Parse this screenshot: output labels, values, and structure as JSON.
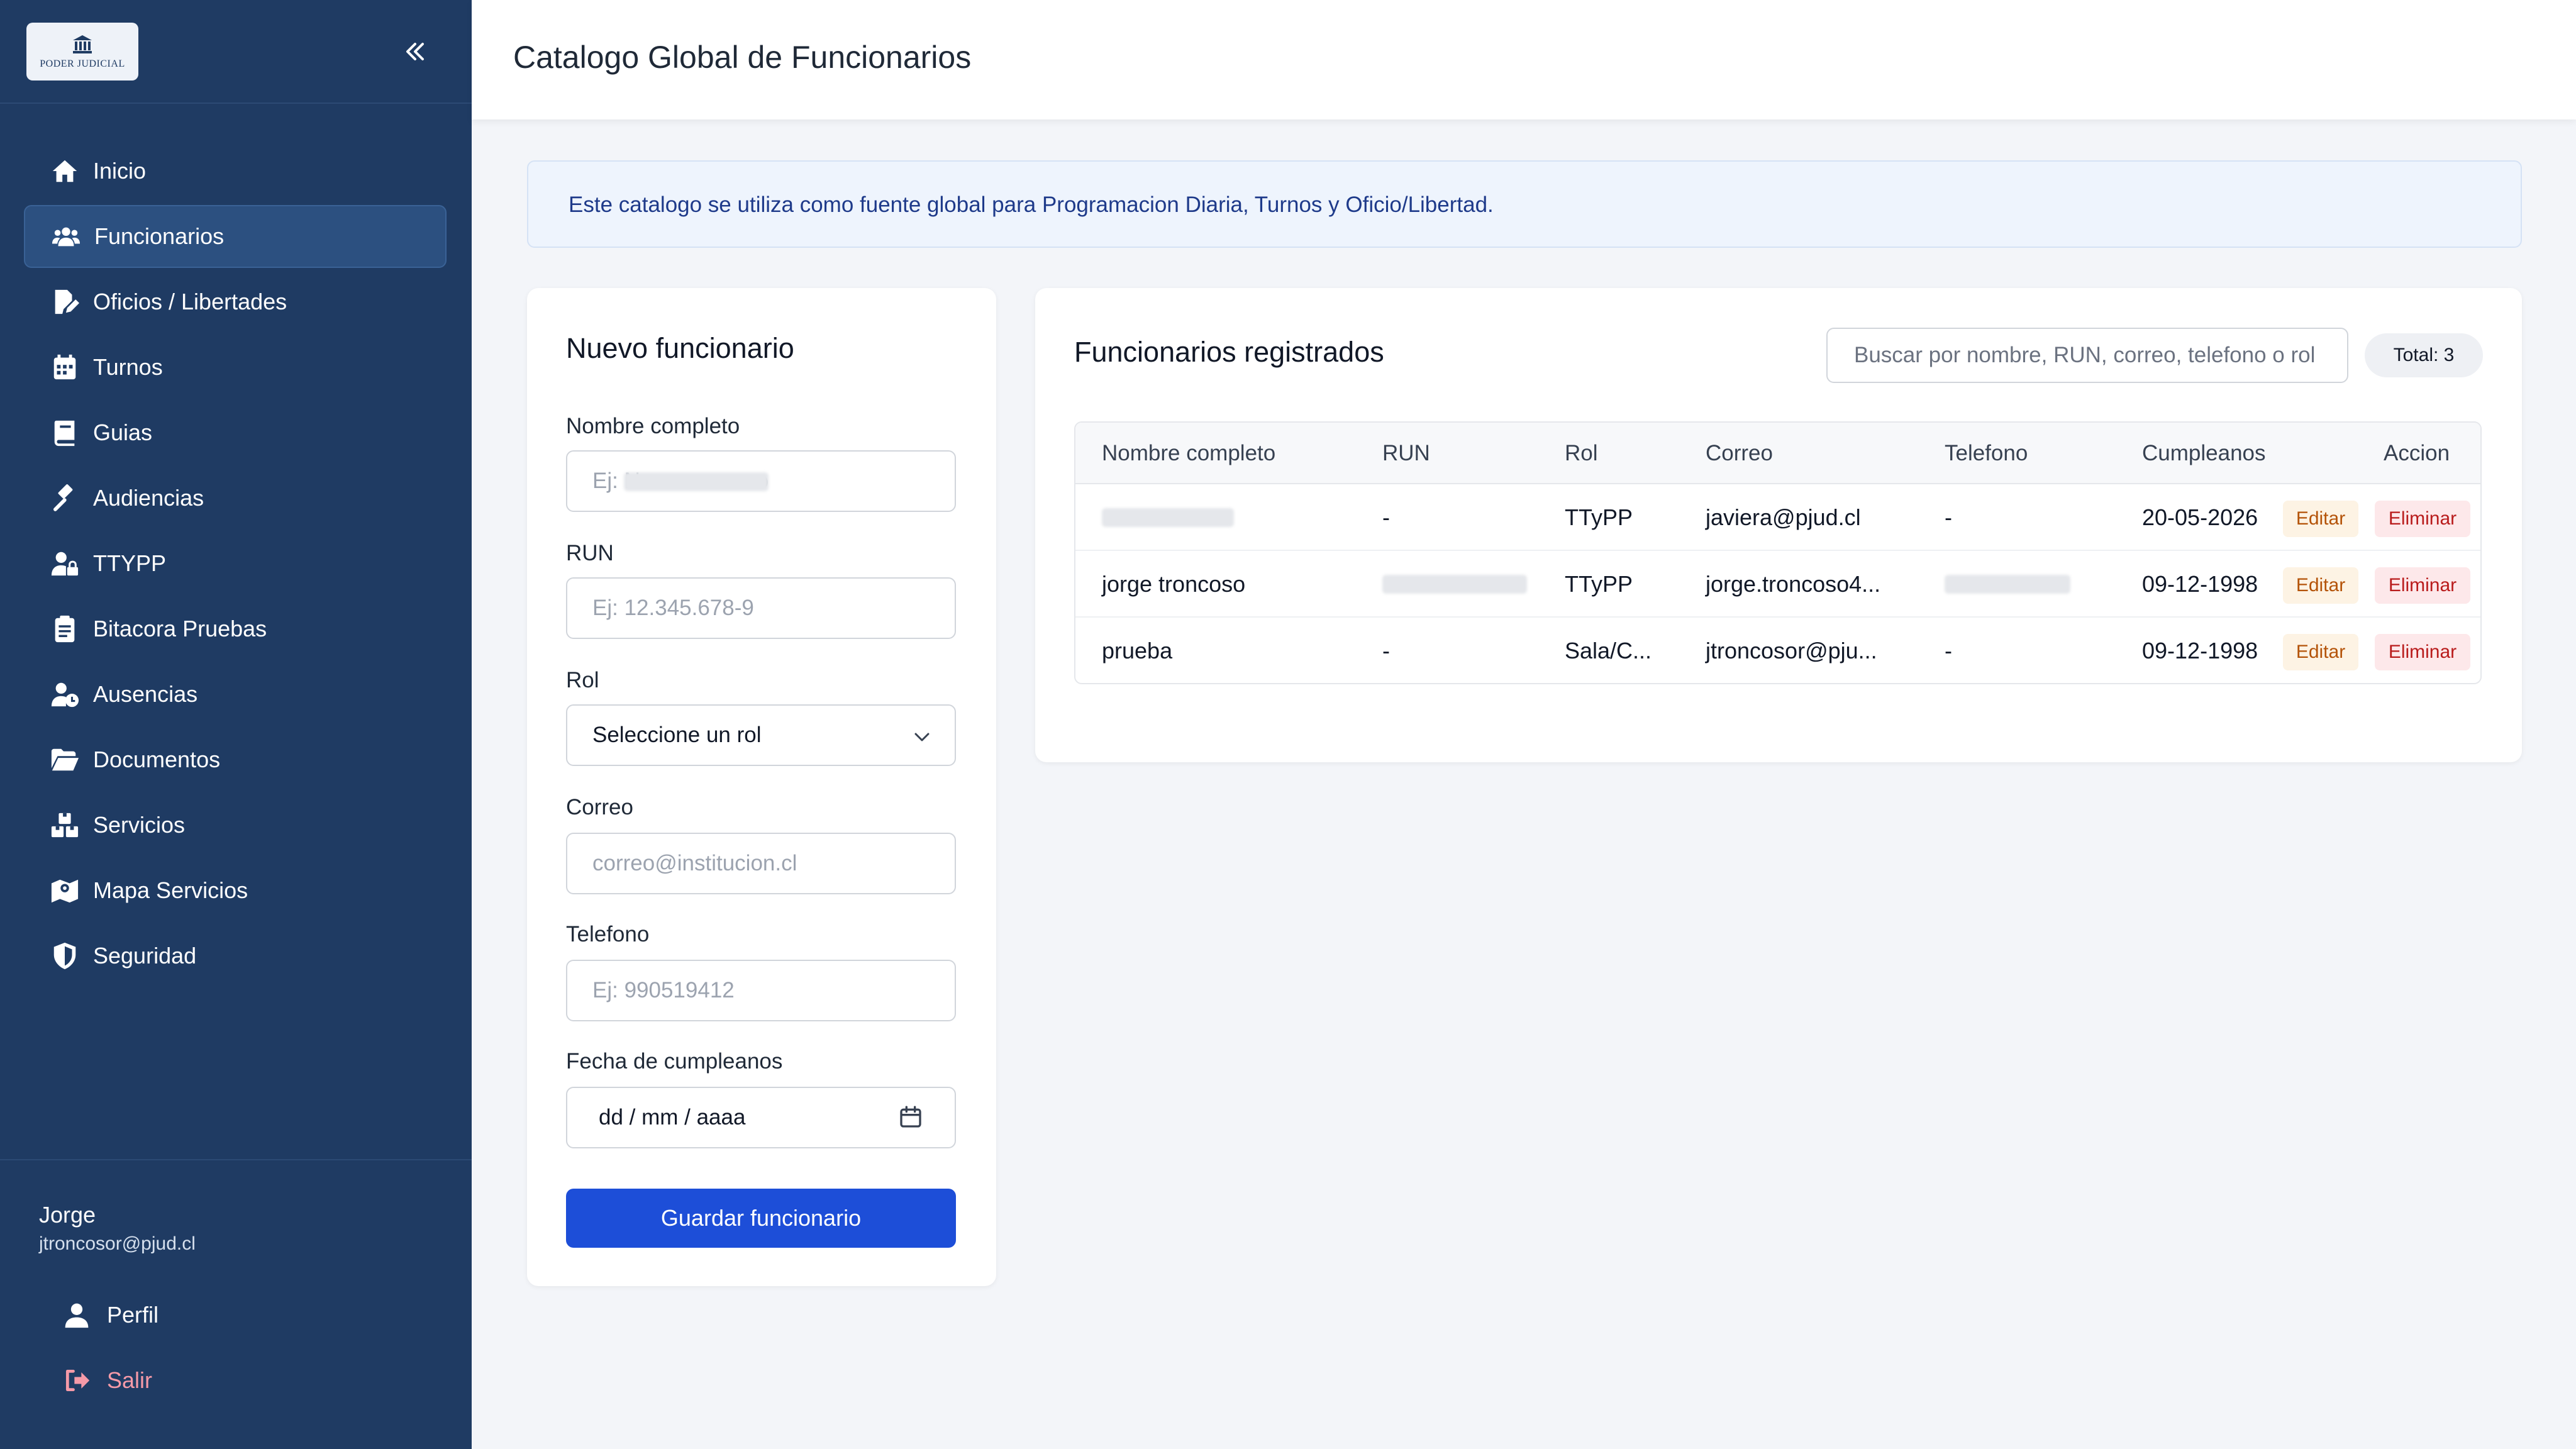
{
  "sidebar": {
    "logo_text": "PODER JUDICIAL",
    "items": [
      {
        "label": "Inicio",
        "icon": "home-icon",
        "active": false
      },
      {
        "label": "Funcionarios",
        "icon": "users-icon",
        "active": true
      },
      {
        "label": "Oficios / Libertades",
        "icon": "document-edit-icon",
        "active": false
      },
      {
        "label": "Turnos",
        "icon": "calendar-icon",
        "active": false
      },
      {
        "label": "Guias",
        "icon": "book-icon",
        "active": false
      },
      {
        "label": "Audiencias",
        "icon": "gavel-icon",
        "active": false
      },
      {
        "label": "TTYPP",
        "icon": "user-lock-icon",
        "active": false
      },
      {
        "label": "Bitacora Pruebas",
        "icon": "clipboard-icon",
        "active": false
      },
      {
        "label": "Ausencias",
        "icon": "user-clock-icon",
        "active": false
      },
      {
        "label": "Documentos",
        "icon": "folder-open-icon",
        "active": false
      },
      {
        "label": "Servicios",
        "icon": "boxes-icon",
        "active": false
      },
      {
        "label": "Mapa Servicios",
        "icon": "map-icon",
        "active": false
      },
      {
        "label": "Seguridad",
        "icon": "shield-icon",
        "active": false
      }
    ],
    "user": {
      "name": "Jorge",
      "email": "jtroncosor@pjud.cl"
    },
    "perfil_label": "Perfil",
    "salir_label": "Salir"
  },
  "header": {
    "title": "Catalogo Global de Funcionarios"
  },
  "banner": {
    "text": "Este catalogo se utiliza como fuente global para Programacion Diaria, Turnos y Oficio/Libertad."
  },
  "form": {
    "title": "Nuevo funcionario",
    "nombre_label": "Nombre completo",
    "nombre_placeholder": "Ej: N                   o",
    "run_label": "RUN",
    "run_placeholder": "Ej: 12.345.678-9",
    "rol_label": "Rol",
    "rol_value": "Seleccione un rol",
    "correo_label": "Correo",
    "correo_placeholder": "correo@institucion.cl",
    "telefono_label": "Telefono",
    "telefono_placeholder": "Ej: 990519412",
    "fecha_label": "Fecha de cumpleanos",
    "fecha_value": "dd / mm / aaaa",
    "save_label": "Guardar funcionario"
  },
  "registry": {
    "title": "Funcionarios registrados",
    "search_placeholder": "Buscar por nombre, RUN, correo, telefono o rol",
    "total": "Total: 3",
    "columns": [
      "Nombre completo",
      "RUN",
      "Rol",
      "Correo",
      "Telefono",
      "Cumpleanos",
      "Accion"
    ],
    "rows": [
      {
        "nombre": "",
        "run": "-",
        "rol": "TTyPP",
        "correo": "javiera@pjud.cl",
        "telefono": "-",
        "cumpleanos": "20-05-2026"
      },
      {
        "nombre": "jorge troncoso",
        "run": "",
        "rol": "TTyPP",
        "correo": "jorge.troncoso4...",
        "telefono": "",
        "cumpleanos": "09-12-1998"
      },
      {
        "nombre": "prueba",
        "run": "-",
        "rol": "Sala/C...",
        "correo": "jtroncosor@pju...",
        "telefono": "-",
        "cumpleanos": "09-12-1998"
      }
    ],
    "edit_label": "Editar",
    "delete_label": "Eliminar"
  }
}
